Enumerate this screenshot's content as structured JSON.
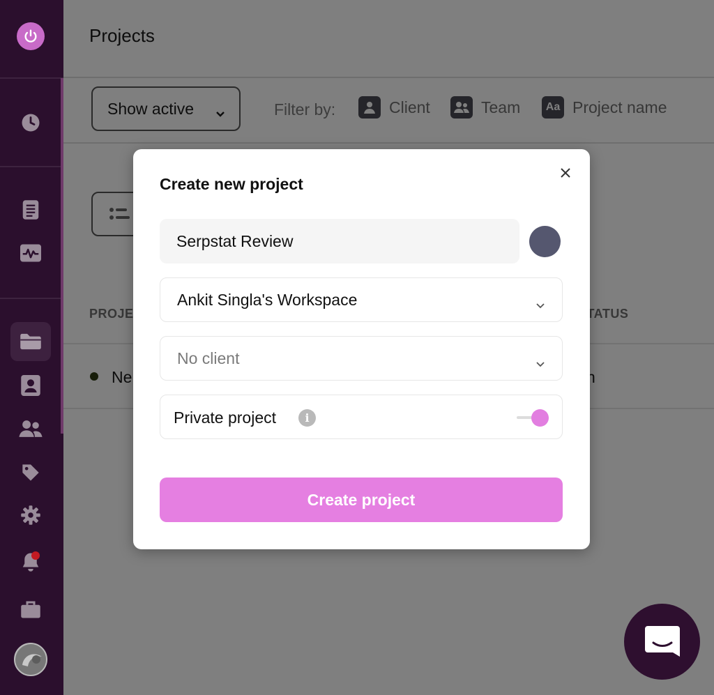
{
  "page": {
    "title": "Projects"
  },
  "toolbar": {
    "show_active_label": "Show active",
    "filter_by_label": "Filter by:",
    "filters": [
      {
        "label": "Client",
        "icon": "user-icon"
      },
      {
        "label": "Team",
        "icon": "team-icon"
      },
      {
        "label": "Project name",
        "icon": "text-aa-icon",
        "icon_text": "Aa"
      }
    ]
  },
  "table": {
    "columns": [
      "PROJE",
      "STATUS"
    ],
    "row_text_left": "Ne",
    "row_text_right": "h"
  },
  "modal": {
    "title": "Create new project",
    "name_value": "Serpstat Review",
    "color": "#55576f",
    "workspace_value": "Ankit Singla's Workspace",
    "client_value": "No client",
    "private_label": "Private project",
    "private_enabled": true,
    "create_label": "Create project"
  },
  "colors": {
    "sidebar": "#2b0f2d",
    "accent": "#e57fe1",
    "notification": "#c21a22"
  }
}
